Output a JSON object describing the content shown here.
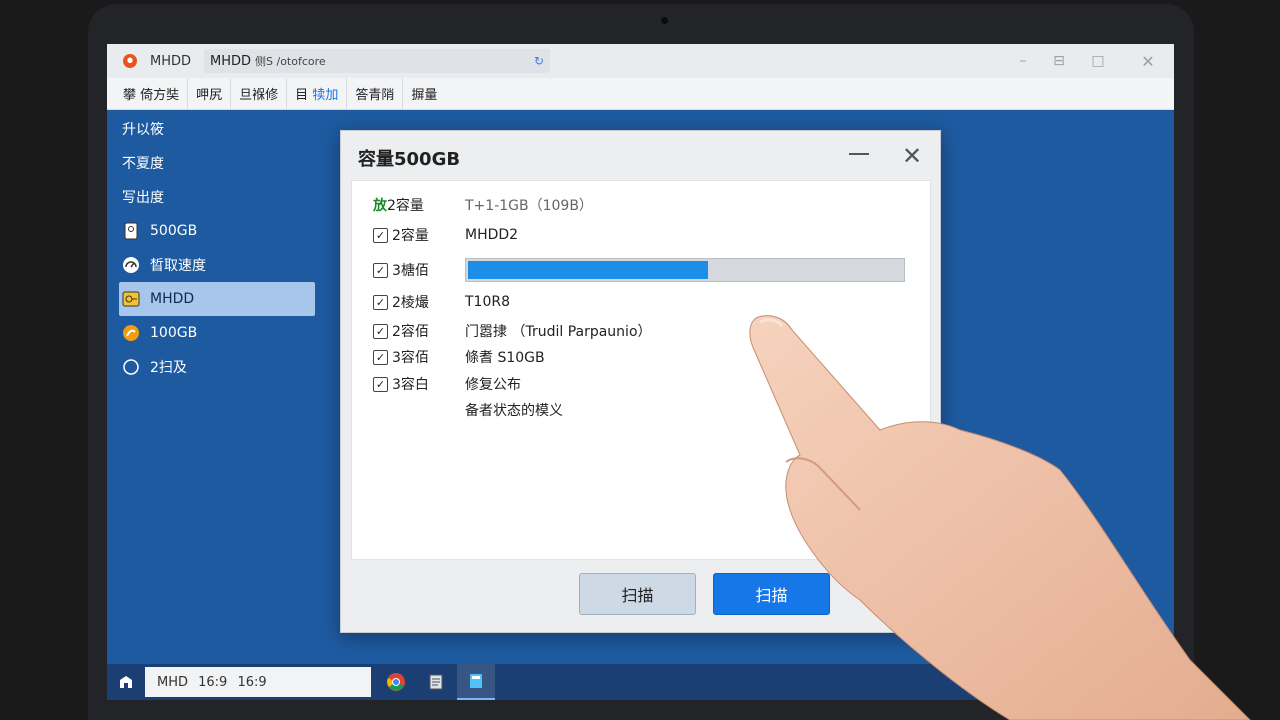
{
  "window": {
    "app_name": "MHDD",
    "address_main": "MHDD",
    "address_sub": "侧S /otofcore",
    "controls": [
      "minimize",
      "restore",
      "maximize",
      "close"
    ]
  },
  "menu": [
    "攀 倚方奘",
    "呷尻",
    "旦褓修",
    "目 犊加",
    "答青陗",
    "摒量"
  ],
  "sidebar": [
    {
      "label": "升以筱",
      "icon": ""
    },
    {
      "label": "不夏度",
      "icon": ""
    },
    {
      "label": "写出度",
      "icon": ""
    },
    {
      "label": "500GB",
      "icon": "drive-icon"
    },
    {
      "label": "晳取速度",
      "icon": "gauge-icon"
    },
    {
      "label": "MHDD",
      "icon": "mhdd-icon",
      "active": true
    },
    {
      "label": "100GB",
      "icon": "disk-icon"
    },
    {
      "label": "2扫及",
      "icon": "circle-icon"
    }
  ],
  "dialog": {
    "title": "容量500GB",
    "rows": [
      {
        "label_prefix": "放",
        "label": "2容量",
        "value": "T+1-1GB（109B）",
        "checked": null
      },
      {
        "label": "2容量",
        "value": "MHDD2",
        "checked": true
      },
      {
        "label": "3榶佰",
        "value": "",
        "checked": true,
        "progress": 0.55
      },
      {
        "label": "2棱熶",
        "value": "T10R8",
        "checked": true
      },
      {
        "label": "2容佰",
        "value": "门嚣捸 （Trudil Parpaunio）",
        "checked": true
      },
      {
        "label": "3容佰",
        "value": "條耆 S10GB",
        "checked": true
      },
      {
        "label": "3容白",
        "value": "修复公布",
        "checked": true
      },
      {
        "label": "",
        "value": "备者状态的模义",
        "checked": null
      }
    ],
    "buttons": {
      "secondary": "扫描",
      "primary": "扫描"
    }
  },
  "taskbar": {
    "search_text": "MHD 16:9 16:9",
    "apps": [
      "start-icon",
      "chrome-icon",
      "notes-icon",
      "files-icon"
    ]
  },
  "colors": {
    "desktop": "#1e5aa0",
    "accent": "#1677e8",
    "progress": "#1d8ee8",
    "sidebar_active": "#a8c6ec"
  }
}
